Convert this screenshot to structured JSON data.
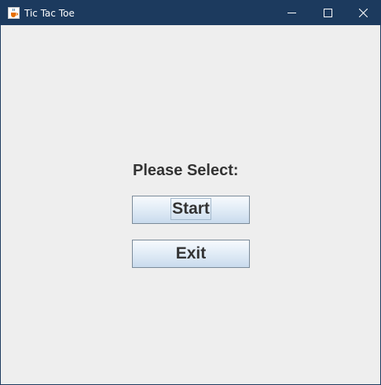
{
  "window": {
    "title": "Tic Tac Toe",
    "icon": "java-cup-icon",
    "controls": [
      "minimize-icon",
      "maximize-icon",
      "close-icon"
    ]
  },
  "menu": {
    "prompt": "Please Select:",
    "start_label": "Start",
    "exit_label": "Exit",
    "focused": "Start"
  },
  "colors": {
    "titlebar": "#1c3a5e",
    "background": "#eeeeee",
    "text": "#333333",
    "button_border": "#7a8a99"
  }
}
